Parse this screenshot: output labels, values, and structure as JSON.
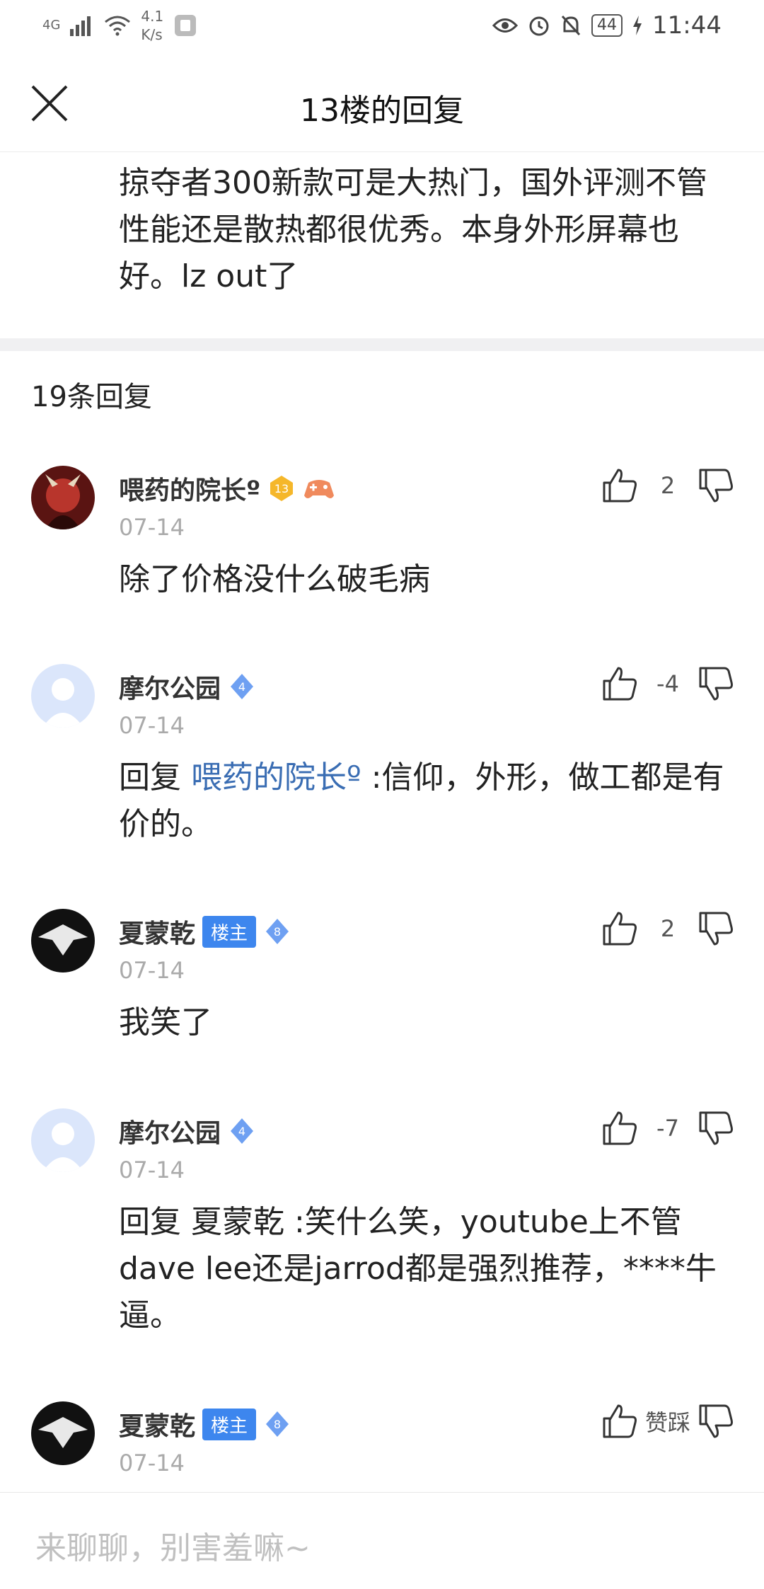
{
  "status_bar": {
    "network": "4G",
    "speed_value": "4.1",
    "speed_unit": "K/s",
    "battery": "44",
    "time": "11:44"
  },
  "header": {
    "title": "13楼的回复"
  },
  "original_post": {
    "text": "掠夺者300新款可是大热门，国外评测不管性能还是散热都很优秀。本身外形屏幕也好。lz out了"
  },
  "reply_count": "19条回复",
  "comments": [
    {
      "name": "喂药的院长º",
      "level": "13",
      "date": "07-14",
      "likes": "2",
      "text": "除了价格没什么破毛病"
    },
    {
      "name": "摩尔公园",
      "level": "4",
      "date": "07-14",
      "likes": "-4",
      "reply_prefix": "回复 ",
      "mention": "喂药的院长º",
      "text": " :信仰，外形，做工都是有价的。"
    },
    {
      "name": "夏蒙乾",
      "badge": "楼主",
      "level": "8",
      "date": "07-14",
      "likes": "2",
      "text": "我笑了"
    },
    {
      "name": "摩尔公园",
      "level": "4",
      "date": "07-14",
      "likes": "-7",
      "text": "回复 夏蒙乾 :笑什么笑，youtube上不管dave lee还是jarrod都是强烈推荐，****牛逼。"
    },
    {
      "name": "夏蒙乾",
      "badge": "楼主",
      "level": "8",
      "date": "07-14",
      "likes": "赞踩"
    }
  ],
  "input": {
    "placeholder": "来聊聊，别害羞嘛~"
  },
  "colors": {
    "accent_blue": "#3d86ee",
    "mention": "#3a6db3",
    "divider": "#f0f0f2"
  }
}
